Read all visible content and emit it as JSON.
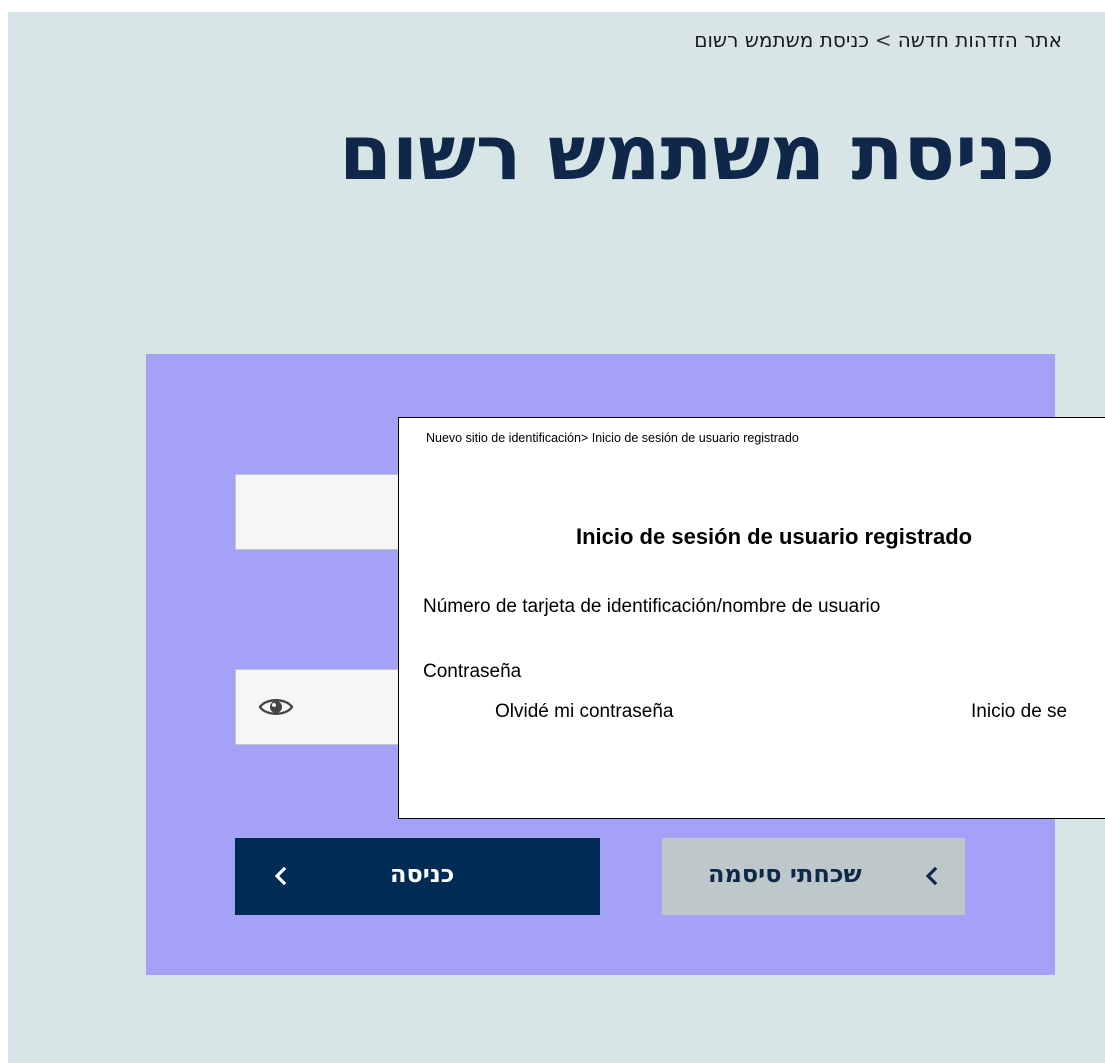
{
  "breadcrumb": {
    "home": "אתר הזדהות חדשה",
    "separator": ">",
    "current": "כניסת משתמש רשום"
  },
  "page_title": "כניסת משתמש רשום",
  "form": {
    "username_value": "",
    "password_value": "",
    "password_toggle_icon": "eye-icon",
    "login_button_label": "כניסה",
    "forgot_button_label": "שכחתי סיסמה"
  },
  "translation_overlay": {
    "breadcrumb": "Nuevo sitio de identificación> Inicio de sesión de usuario registrado",
    "title": "Inicio de sesión de usuario registrado",
    "username_label": "Número de tarjeta de identificación/nombre de usuario",
    "password_label": "Contraseña",
    "forgot_label": "Olvidé mi contraseña",
    "login_label": "Inicio de se"
  },
  "colors": {
    "page_background": "#d8e5e7",
    "card_background": "#a3a2f7",
    "title_color": "#0f2748",
    "login_button": "#002b55",
    "forgot_button": "#bec8ca"
  }
}
